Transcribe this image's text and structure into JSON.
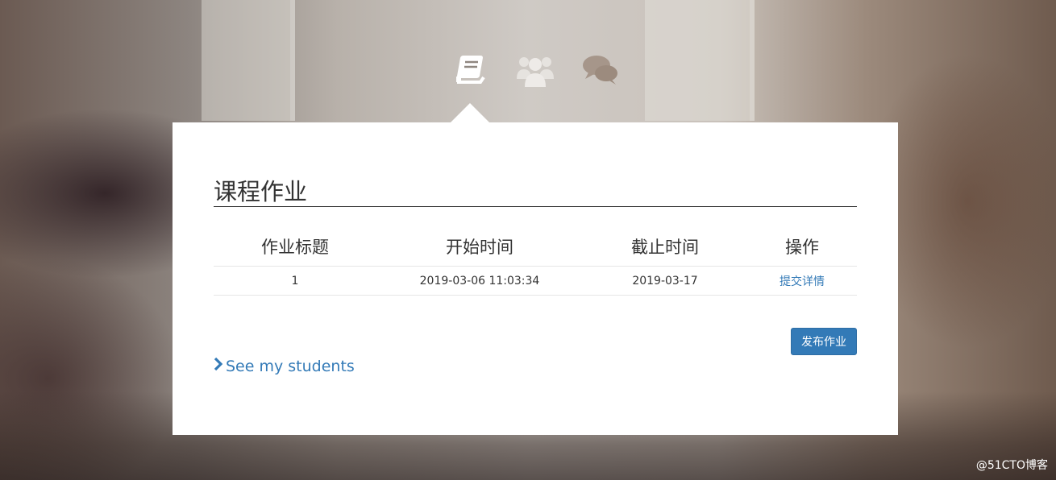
{
  "top_nav": {
    "icons": [
      "book-icon",
      "users-icon",
      "comments-icon"
    ]
  },
  "panel": {
    "title": "课程作业",
    "table": {
      "headers": [
        "作业标题",
        "开始时间",
        "截止时间",
        "操作"
      ],
      "rows": [
        {
          "title": "1",
          "start": "2019-03-06 11:03:34",
          "deadline": "2019-03-17",
          "action": "提交详情"
        }
      ]
    },
    "publish_label": "发布作业",
    "students_link": "See my students"
  },
  "watermark": "@51CTO博客",
  "colors": {
    "accent": "#337ab7",
    "panel": "#ffffff",
    "text": "#333333"
  }
}
